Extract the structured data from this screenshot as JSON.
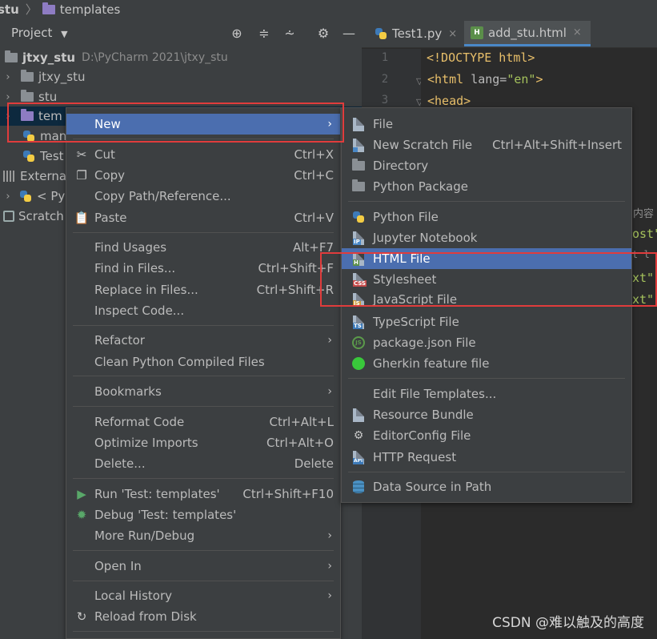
{
  "breadcrumb": {
    "project": "stu",
    "folder": "templates"
  },
  "project_panel": {
    "title": "Project",
    "dropdown_icon": "chevron-down-icon",
    "tools": [
      "target-icon",
      "expand-icon",
      "collapse-icon",
      "gear-icon",
      "minimize-icon"
    ],
    "tree": [
      {
        "label": "jtxy_stu",
        "hint": "D:\\PyCharm 2021\\jtxy_stu"
      },
      {
        "label": "jtxy_stu"
      },
      {
        "label": "stu"
      },
      {
        "label": "tem"
      },
      {
        "label": "man"
      },
      {
        "label": "Test"
      },
      {
        "label": "Externa"
      },
      {
        "label": "< Py"
      },
      {
        "label": "Scratch"
      }
    ]
  },
  "editor": {
    "tabs": [
      {
        "label": "Test1.py",
        "close": "×"
      },
      {
        "label": "add_stu.html",
        "close": "×",
        "icon_badge": "H"
      }
    ],
    "line_numbers": [
      "1",
      "2",
      "3"
    ],
    "code": {
      "line1": "<!DOCTYPE html>",
      "line2_tag_open": "<html ",
      "line2_attr": "lang=",
      "line2_val": "\"en\"",
      "line2_close": ">",
      "line3": "<head>"
    },
    "fragments": [
      "内容",
      "ost\"",
      "t l",
      "xt\"",
      "xt\""
    ]
  },
  "context_menu": {
    "items": [
      {
        "label": "New",
        "submenu": "›"
      },
      {
        "label": "Cut",
        "shortcut": "Ctrl+X",
        "icon": "scissors-icon"
      },
      {
        "label": "Copy",
        "shortcut": "Ctrl+C",
        "icon": "copy-icon"
      },
      {
        "label": "Copy Path/Reference..."
      },
      {
        "label": "Paste",
        "shortcut": "Ctrl+V",
        "icon": "paste-icon"
      },
      {
        "label": "Find Usages",
        "shortcut": "Alt+F7"
      },
      {
        "label": "Find in Files...",
        "shortcut": "Ctrl+Shift+F"
      },
      {
        "label": "Replace in Files...",
        "shortcut": "Ctrl+Shift+R"
      },
      {
        "label": "Inspect Code..."
      },
      {
        "label": "Refactor",
        "submenu": "›"
      },
      {
        "label": "Clean Python Compiled Files"
      },
      {
        "label": "Bookmarks",
        "submenu": "›"
      },
      {
        "label": "Reformat Code",
        "shortcut": "Ctrl+Alt+L"
      },
      {
        "label": "Optimize Imports",
        "shortcut": "Ctrl+Alt+O"
      },
      {
        "label": "Delete...",
        "shortcut": "Delete"
      },
      {
        "label": "Run 'Test: templates'",
        "shortcut": "Ctrl+Shift+F10",
        "icon": "run-icon"
      },
      {
        "label": "Debug 'Test: templates'",
        "icon": "debug-icon"
      },
      {
        "label": "More Run/Debug",
        "submenu": "›"
      },
      {
        "label": "Open In",
        "submenu": "›"
      },
      {
        "label": "Local History",
        "submenu": "›"
      },
      {
        "label": "Reload from Disk",
        "icon": "reload-icon"
      }
    ]
  },
  "new_submenu": {
    "items": [
      {
        "label": "File"
      },
      {
        "label": "New Scratch File",
        "shortcut": "Ctrl+Alt+Shift+Insert"
      },
      {
        "label": "Directory"
      },
      {
        "label": "Python Package"
      },
      {
        "label": "Python File"
      },
      {
        "label": "Jupyter Notebook",
        "badge": "IP"
      },
      {
        "label": "HTML File",
        "badge": "H"
      },
      {
        "label": "Stylesheet",
        "badge": "CSS"
      },
      {
        "label": "JavaScript File",
        "badge": "JS"
      },
      {
        "label": "TypeScript File",
        "badge": "TS"
      },
      {
        "label": "package.json File",
        "badge": "JS"
      },
      {
        "label": "Gherkin feature file"
      },
      {
        "label": "Edit File Templates..."
      },
      {
        "label": "Resource Bundle"
      },
      {
        "label": "EditorConfig File"
      },
      {
        "label": "HTTP Request",
        "badge": "API"
      },
      {
        "label": "Data Source in Path"
      }
    ]
  },
  "watermark": "CSDN @难以触及的高度",
  "colors": {
    "selection": "#4b6eaf",
    "highlight_box": "#e03c3c",
    "panel_bg": "#3c3f41",
    "editor_bg": "#2b2b2b"
  }
}
